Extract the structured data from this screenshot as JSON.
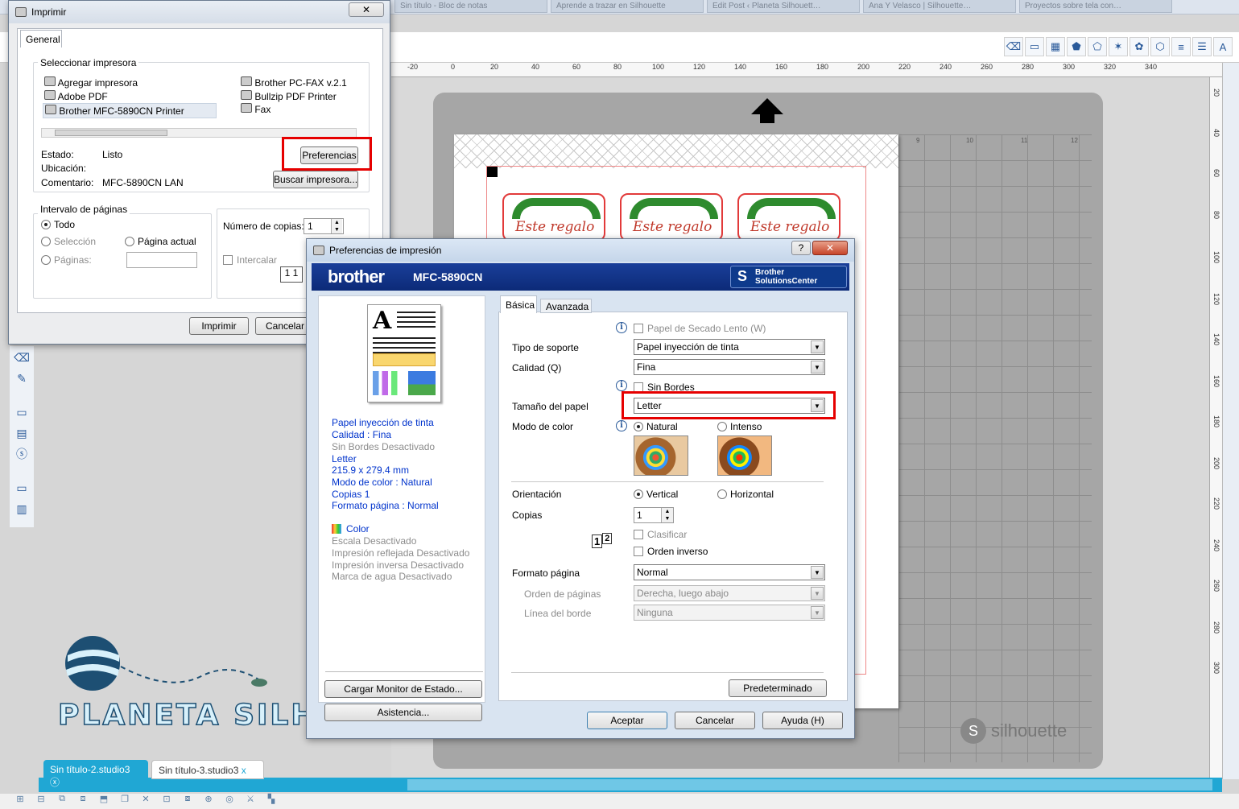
{
  "browser": {
    "tabs": [
      "Sin título - Bloc de notas",
      "Aprende a trazar en Silhouette",
      "Edit Post ‹ Planeta Silhouett…",
      "Ana Y Velasco | Silhouette…",
      "Proyectos sobre tela con…"
    ]
  },
  "ruler": {
    "h_ticks": [
      "-20",
      "0",
      "20",
      "40",
      "60",
      "80",
      "100",
      "120",
      "140",
      "160",
      "180",
      "200",
      "220",
      "240",
      "260",
      "280",
      "300",
      "320",
      "340"
    ],
    "v_ticks": [
      "20",
      "40",
      "60",
      "80",
      "100",
      "120",
      "140",
      "160",
      "180",
      "200",
      "220",
      "240",
      "260",
      "280",
      "300"
    ],
    "mat_cols": [
      "9",
      "10",
      "11",
      "12"
    ]
  },
  "canvas": {
    "tag_text": "Este regalo es"
  },
  "branding": {
    "logo_text": "PLANETA SILHOUETTE",
    "silhouette_mark": "silhouette"
  },
  "doc_tabs": [
    "Sin título-2.studio3",
    "Sin título-3.studio3"
  ],
  "print_dialog": {
    "title": "Imprimir",
    "close": "✕",
    "tab": "General",
    "select_printer_label": "Seleccionar impresora",
    "printers_col1": [
      "Agregar impresora",
      "Adobe PDF",
      "Brother MFC-5890CN Printer"
    ],
    "printers_col2": [
      "Brother PC-FAX v.2.1",
      "Bullzip PDF Printer",
      "Fax"
    ],
    "status_label": "Estado:",
    "status_value": "Listo",
    "location_label": "Ubicación:",
    "comment_label": "Comentario:",
    "comment_value": "MFC-5890CN LAN",
    "preferences_button": "Preferencias",
    "find_printer_button": "Buscar impresora...",
    "page_range_label": "Intervalo de páginas",
    "range_all": "Todo",
    "range_selection": "Selección",
    "range_current": "Página actual",
    "range_pages": "Páginas:",
    "copies_label": "Número de copias:",
    "copies_value": "1",
    "collate_label": "Intercalar",
    "print_button": "Imprimir",
    "cancel_button": "Cancelar"
  },
  "prefs_dialog": {
    "title": "Preferencias de impresión",
    "help": "?",
    "close": "✕",
    "brand": "brother",
    "model": "MFC-5890CN",
    "solutions_line1": "Brother",
    "solutions_line2": "SolutionsCenter",
    "tabs": [
      "Básica",
      "Avanzada"
    ],
    "summary": {
      "media": "Papel inyección de tinta",
      "quality": "Calidad   : Fina",
      "borderless": "Sin Bordes Desactivado",
      "paper": "Letter",
      "size": "215.9 x 279.4 mm",
      "color_mode": "Modo de color : Natural",
      "copies": "Copias 1",
      "page_format": "Formato página : Normal",
      "color": "Color",
      "scale": "Escala Desactivado",
      "mirror": "Impresión reflejada Desactivado",
      "reverse": "Impresión inversa Desactivado",
      "watermark": "Marca de agua Desactivado"
    },
    "status_monitor_button": "Cargar Monitor de Estado...",
    "assist_button": "Asistencia...",
    "slow_dry_label": "Papel de Secado Lento (W)",
    "media_label": "Tipo de soporte",
    "media_value": "Papel inyección de tinta",
    "quality_label": "Calidad (Q)",
    "quality_value": "Fina",
    "borderless_label": "Sin Bordes",
    "paper_size_label": "Tamaño del papel",
    "paper_size_value": "Letter",
    "color_mode_label": "Modo de color",
    "color_natural": "Natural",
    "color_vivid": "Intenso",
    "orientation_label": "Orientación",
    "orient_portrait": "Vertical",
    "orient_landscape": "Horizontal",
    "copies_label": "Copias",
    "copies_value": "1",
    "collate_label": "Clasificar",
    "reverse_order_label": "Orden inverso",
    "page_format_label": "Formato página",
    "page_format_value": "Normal",
    "page_order_label": "Orden de páginas",
    "page_order_value": "Derecha, luego abajo",
    "border_line_label": "Línea del borde",
    "border_line_value": "Ninguna",
    "default_button": "Predeterminado",
    "accept_button": "Aceptar",
    "cancel_button": "Cancelar",
    "help_button": "Ayuda (H)"
  }
}
